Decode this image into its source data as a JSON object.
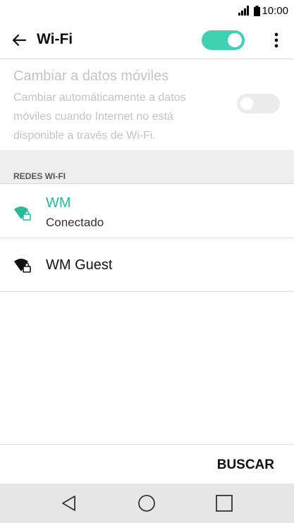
{
  "status_bar": {
    "time": "10:00",
    "signal_icon": "signal-icon",
    "battery_icon": "battery-icon"
  },
  "toolbar": {
    "title": "Wi-Fi",
    "wifi_enabled": true
  },
  "mobile_data": {
    "title": "Cambiar a datos móviles",
    "description": "Cambiar automáticamente a datos móviles cuando Internet no está disponible a través de Wi-Fi.",
    "enabled": false
  },
  "section": {
    "header": "REDES WI-FI"
  },
  "networks": [
    {
      "name": "WM",
      "status": "Conectado",
      "secured": true,
      "connected": true
    },
    {
      "name": "WM Guest",
      "secured": true,
      "connected": false
    }
  ],
  "actions": {
    "scan_label": "BUSCAR"
  },
  "colors": {
    "accent": "#3fd1b1",
    "connected_text": "#26b99a",
    "disabled_text": "#c4c4c4"
  }
}
